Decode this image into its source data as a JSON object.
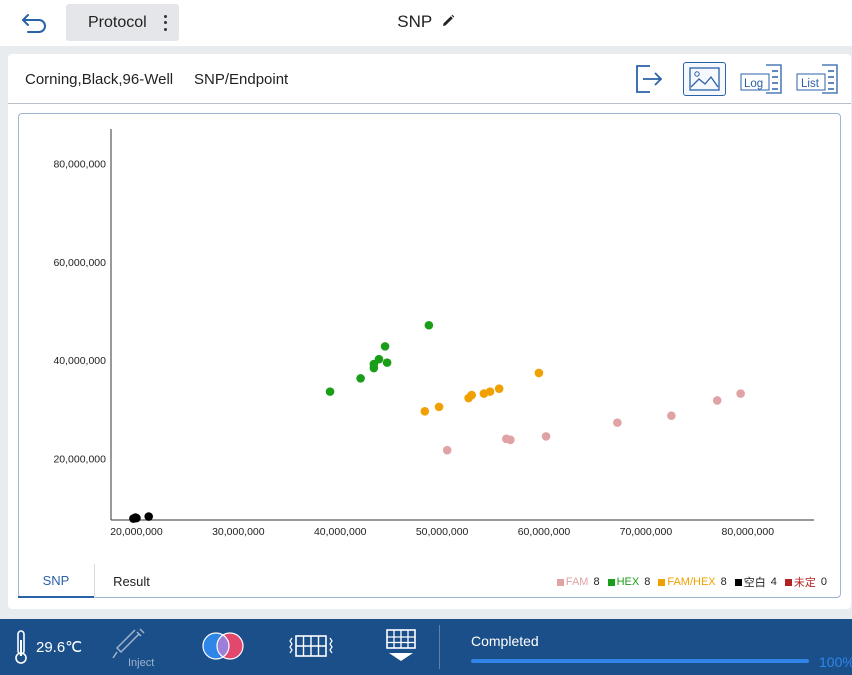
{
  "header": {
    "protocol_label": "Protocol",
    "title": "SNP"
  },
  "toolbar": {
    "plate_name": "Corning,Black,96-Well",
    "mode": "SNP/Endpoint",
    "log_label": "Log",
    "list_label": "List"
  },
  "tabs": [
    {
      "label": "SNP",
      "active": true
    },
    {
      "label": "Result",
      "active": false
    }
  ],
  "legend": [
    {
      "label": "FAM",
      "count": "8",
      "color": "#e0a2a4"
    },
    {
      "label": "HEX",
      "count": "8",
      "color": "#1a9e1a"
    },
    {
      "label": "FAM/HEX",
      "count": "8",
      "color": "#f0a000"
    },
    {
      "label": "空白",
      "count": "4",
      "color": "#000000"
    },
    {
      "label": "未定",
      "count": "0",
      "color": "#b22222"
    }
  ],
  "chart_data": {
    "type": "scatter",
    "x_ticks": [
      "20,000,000",
      "30,000,000",
      "40,000,000",
      "50,000,000",
      "60,000,000",
      "70,000,000",
      "80,000,000"
    ],
    "y_ticks": [
      "20,000,000",
      "40,000,000",
      "60,000,000",
      "80,000,000"
    ],
    "xlim": [
      17500000,
      86500000
    ],
    "ylim": [
      7500000,
      87000000
    ],
    "series": [
      {
        "name": "FAM",
        "color": "#e0a2a4",
        "points": [
          [
            50500000,
            21700000
          ],
          [
            56300000,
            24000000
          ],
          [
            56700000,
            23800000
          ],
          [
            60200000,
            24500000
          ],
          [
            67200000,
            27300000
          ],
          [
            72500000,
            28700000
          ],
          [
            77000000,
            31800000
          ],
          [
            79300000,
            33200000
          ]
        ]
      },
      {
        "name": "HEX",
        "color": "#1a9e1a",
        "points": [
          [
            39000000,
            33600000
          ],
          [
            42000000,
            36300000
          ],
          [
            43300000,
            38400000
          ],
          [
            43300000,
            39200000
          ],
          [
            43800000,
            40200000
          ],
          [
            44600000,
            39500000
          ],
          [
            44400000,
            42800000
          ],
          [
            48700000,
            47100000
          ]
        ]
      },
      {
        "name": "FAM/HEX",
        "color": "#f0a000",
        "points": [
          [
            48300000,
            29600000
          ],
          [
            49700000,
            30500000
          ],
          [
            52600000,
            32300000
          ],
          [
            52900000,
            32900000
          ],
          [
            54100000,
            33200000
          ],
          [
            54700000,
            33600000
          ],
          [
            55600000,
            34200000
          ],
          [
            59500000,
            37400000
          ]
        ]
      },
      {
        "name": "空白",
        "color": "#000000",
        "points": [
          [
            19700000,
            7800000
          ],
          [
            19900000,
            8000000
          ],
          [
            20000000,
            7900000
          ],
          [
            21200000,
            8200000
          ]
        ]
      }
    ]
  },
  "status": {
    "temperature": "29.6℃",
    "inject_label": "Inject",
    "run_status": "Completed",
    "progress": 1.0,
    "progress_label": "100%"
  }
}
